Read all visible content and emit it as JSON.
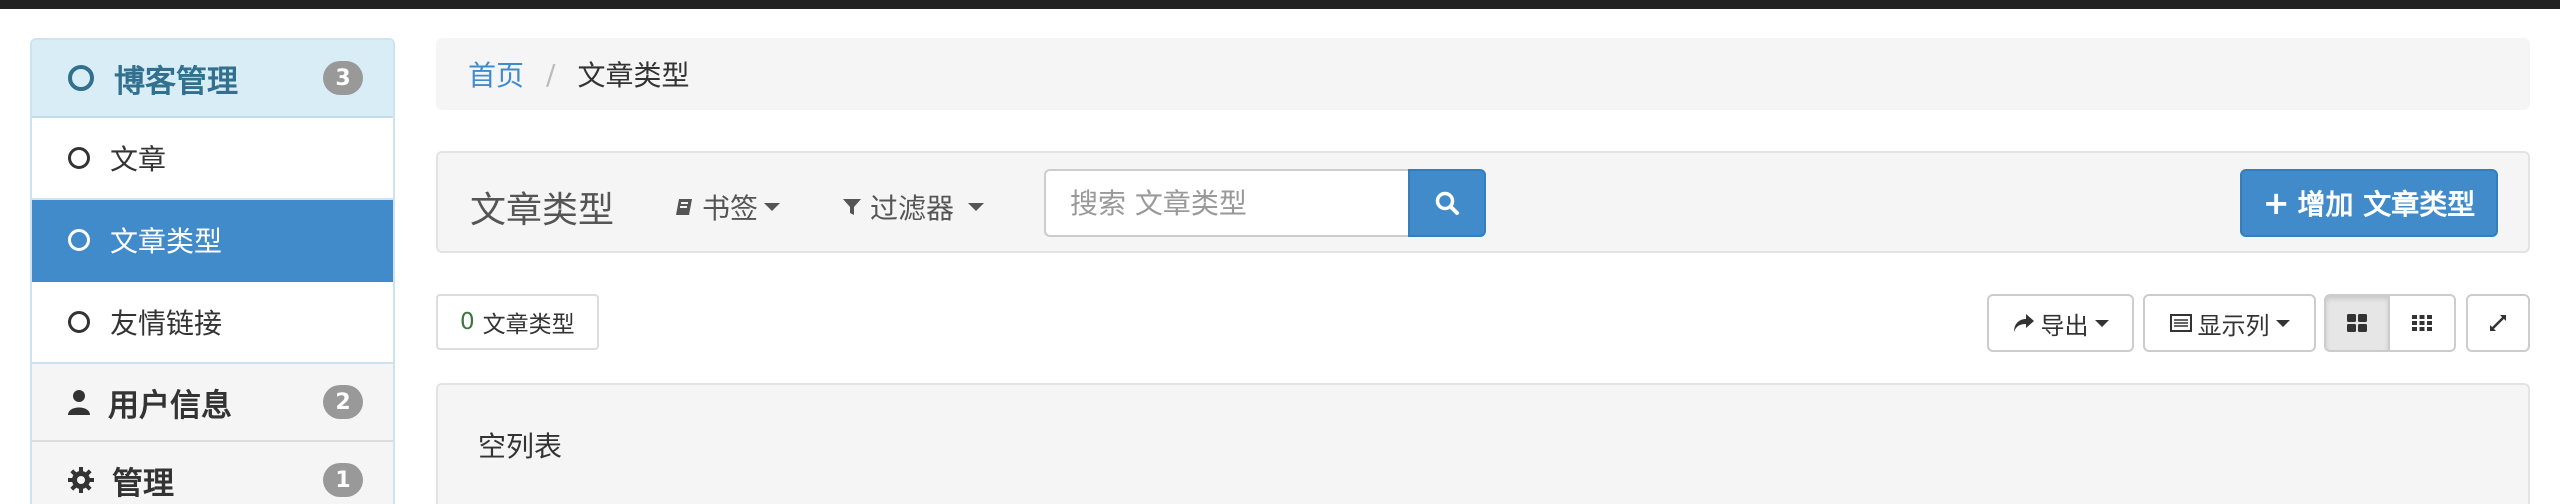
{
  "sidebar": {
    "blog_group": {
      "title": "博客管理",
      "badge": "3"
    },
    "items": [
      {
        "label": "文章"
      },
      {
        "label": "文章类型"
      },
      {
        "label": "友情链接"
      }
    ],
    "user_group": {
      "title": "用户信息",
      "badge": "2"
    },
    "admin_group": {
      "title": "管理",
      "badge": "1"
    }
  },
  "breadcrumb": {
    "home": "首页",
    "separator": "/",
    "current": "文章类型"
  },
  "toolbar": {
    "title": "文章类型",
    "bookmarks": "书签",
    "filters": "过滤器",
    "search_placeholder": "搜索 文章类型",
    "add_button": "增加 文章类型"
  },
  "list": {
    "count": "0",
    "count_label": "文章类型",
    "export": "导出",
    "columns": "显示列",
    "empty": "空列表"
  },
  "colors": {
    "primary": "#428bca",
    "group_bg": "#d9edf7",
    "group_text": "#31708f",
    "topbar": "#222222"
  },
  "icons": [
    "circle-icon",
    "user-icon",
    "gear-icon",
    "book-icon",
    "filter-icon",
    "search-icon",
    "plus-icon",
    "share-icon",
    "list-icon",
    "grid-large-icon",
    "grid-small-icon",
    "fullscreen-icon"
  ]
}
